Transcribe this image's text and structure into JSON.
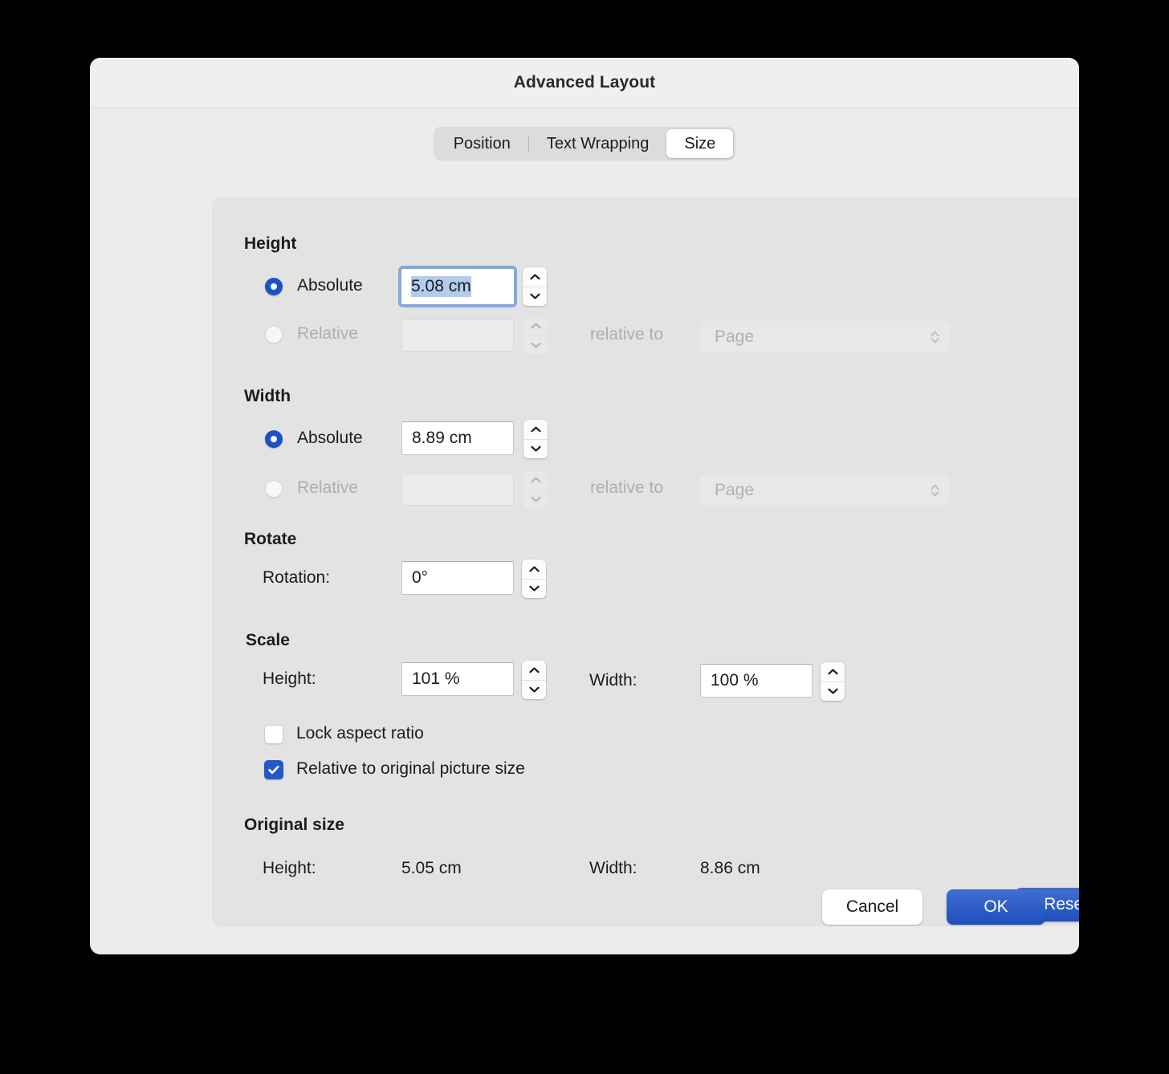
{
  "dialog": {
    "title": "Advanced Layout"
  },
  "tabs": [
    {
      "label": "Position",
      "active": false
    },
    {
      "label": "Text Wrapping",
      "active": false
    },
    {
      "label": "Size",
      "active": true
    }
  ],
  "height_section": {
    "title": "Height",
    "absolute_label": "Absolute",
    "absolute_value": "5.08 cm",
    "relative_label": "Relative",
    "relative_value": "",
    "relative_to_label": "relative to",
    "relative_to_value": "Page"
  },
  "width_section": {
    "title": "Width",
    "absolute_label": "Absolute",
    "absolute_value": "8.89 cm",
    "relative_label": "Relative",
    "relative_value": "",
    "relative_to_label": "relative to",
    "relative_to_value": "Page"
  },
  "rotate_section": {
    "title": "Rotate",
    "rotation_label": "Rotation:",
    "rotation_value": "0°"
  },
  "scale_section": {
    "title": "Scale",
    "height_label": "Height:",
    "height_value": "101 %",
    "width_label": "Width:",
    "width_value": "100 %",
    "lock_aspect_label": "Lock aspect ratio",
    "relative_original_label": "Relative to original picture size"
  },
  "original_size_section": {
    "title": "Original size",
    "height_label": "Height:",
    "height_value": "5.05 cm",
    "width_label": "Width:",
    "width_value": "8.86 cm"
  },
  "buttons": {
    "reset": "Reset",
    "cancel": "Cancel",
    "ok": "OK"
  },
  "colors": {
    "accent_blue": "#1f4fbd",
    "radio_blue": "#1b52c4",
    "checkbox_blue": "#2159c9",
    "selection_blue": "#b3cced",
    "panel_bg": "#e3e3e3",
    "dialog_bg": "#ececec",
    "titlebar_bg": "#efefef"
  }
}
